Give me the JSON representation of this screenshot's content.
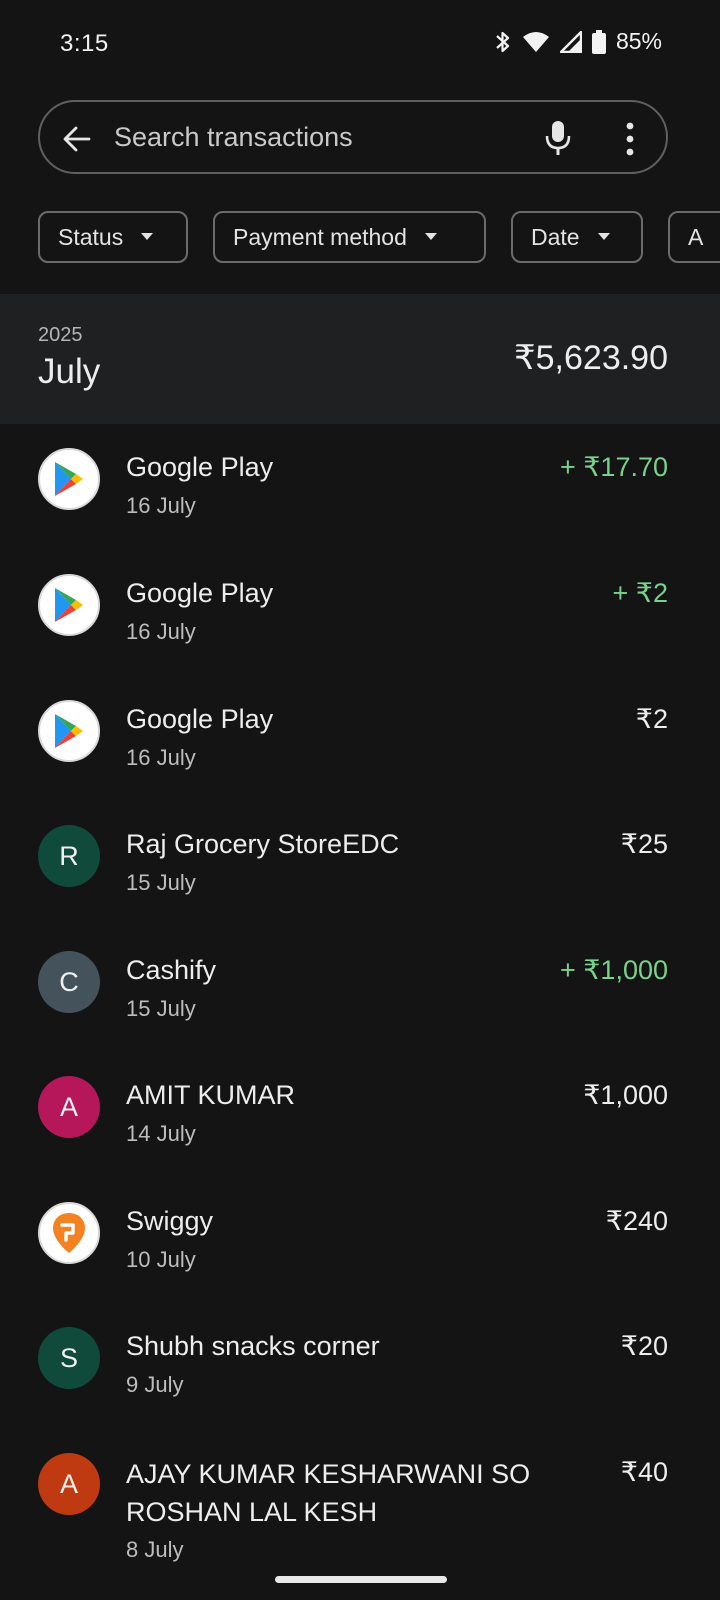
{
  "status_bar": {
    "time": "3:15",
    "battery": "85%"
  },
  "search": {
    "placeholder": "Search transactions"
  },
  "filters": [
    {
      "label": "Status"
    },
    {
      "label": "Payment method"
    },
    {
      "label": "Date"
    },
    {
      "label": "A"
    }
  ],
  "month": {
    "year": "2025",
    "name": "July",
    "total": "₹5,623.90"
  },
  "transactions": [
    {
      "name": "Google Play",
      "date": "16 July",
      "amount": "+ ₹17.70",
      "type": "credit",
      "avatar": "google-play"
    },
    {
      "name": "Google Play",
      "date": "16 July",
      "amount": "+ ₹2",
      "type": "credit",
      "avatar": "google-play"
    },
    {
      "name": "Google Play",
      "date": "16 July",
      "amount": "₹2",
      "type": "debit",
      "avatar": "google-play"
    },
    {
      "name": "Raj Grocery StoreEDC",
      "date": "15 July",
      "amount": "₹25",
      "type": "debit",
      "avatar_letter": "R",
      "avatar_color": "#0f4a3a"
    },
    {
      "name": "Cashify",
      "date": "15 July",
      "amount": "+ ₹1,000",
      "type": "credit",
      "avatar_letter": "C",
      "avatar_color": "#44525c"
    },
    {
      "name": "AMIT KUMAR",
      "date": "14 July",
      "amount": "₹1,000",
      "type": "debit",
      "avatar_letter": "A",
      "avatar_color": "#b5175a"
    },
    {
      "name": "Swiggy",
      "date": "10 July",
      "amount": "₹240",
      "type": "debit",
      "avatar": "swiggy"
    },
    {
      "name": "Shubh snacks corner",
      "date": "9 July",
      "amount": "₹20",
      "type": "debit",
      "avatar_letter": "S",
      "avatar_color": "#0f4a3a"
    },
    {
      "name": "AJAY KUMAR KESHARWANI SO ROSHAN LAL KESH",
      "date": "8 July",
      "amount": "₹40",
      "type": "debit",
      "avatar_letter": "A",
      "avatar_color": "#bf3a10"
    }
  ],
  "colors": {
    "credit": "#79d18b",
    "background": "#141414",
    "month_header": "#1f2022"
  }
}
